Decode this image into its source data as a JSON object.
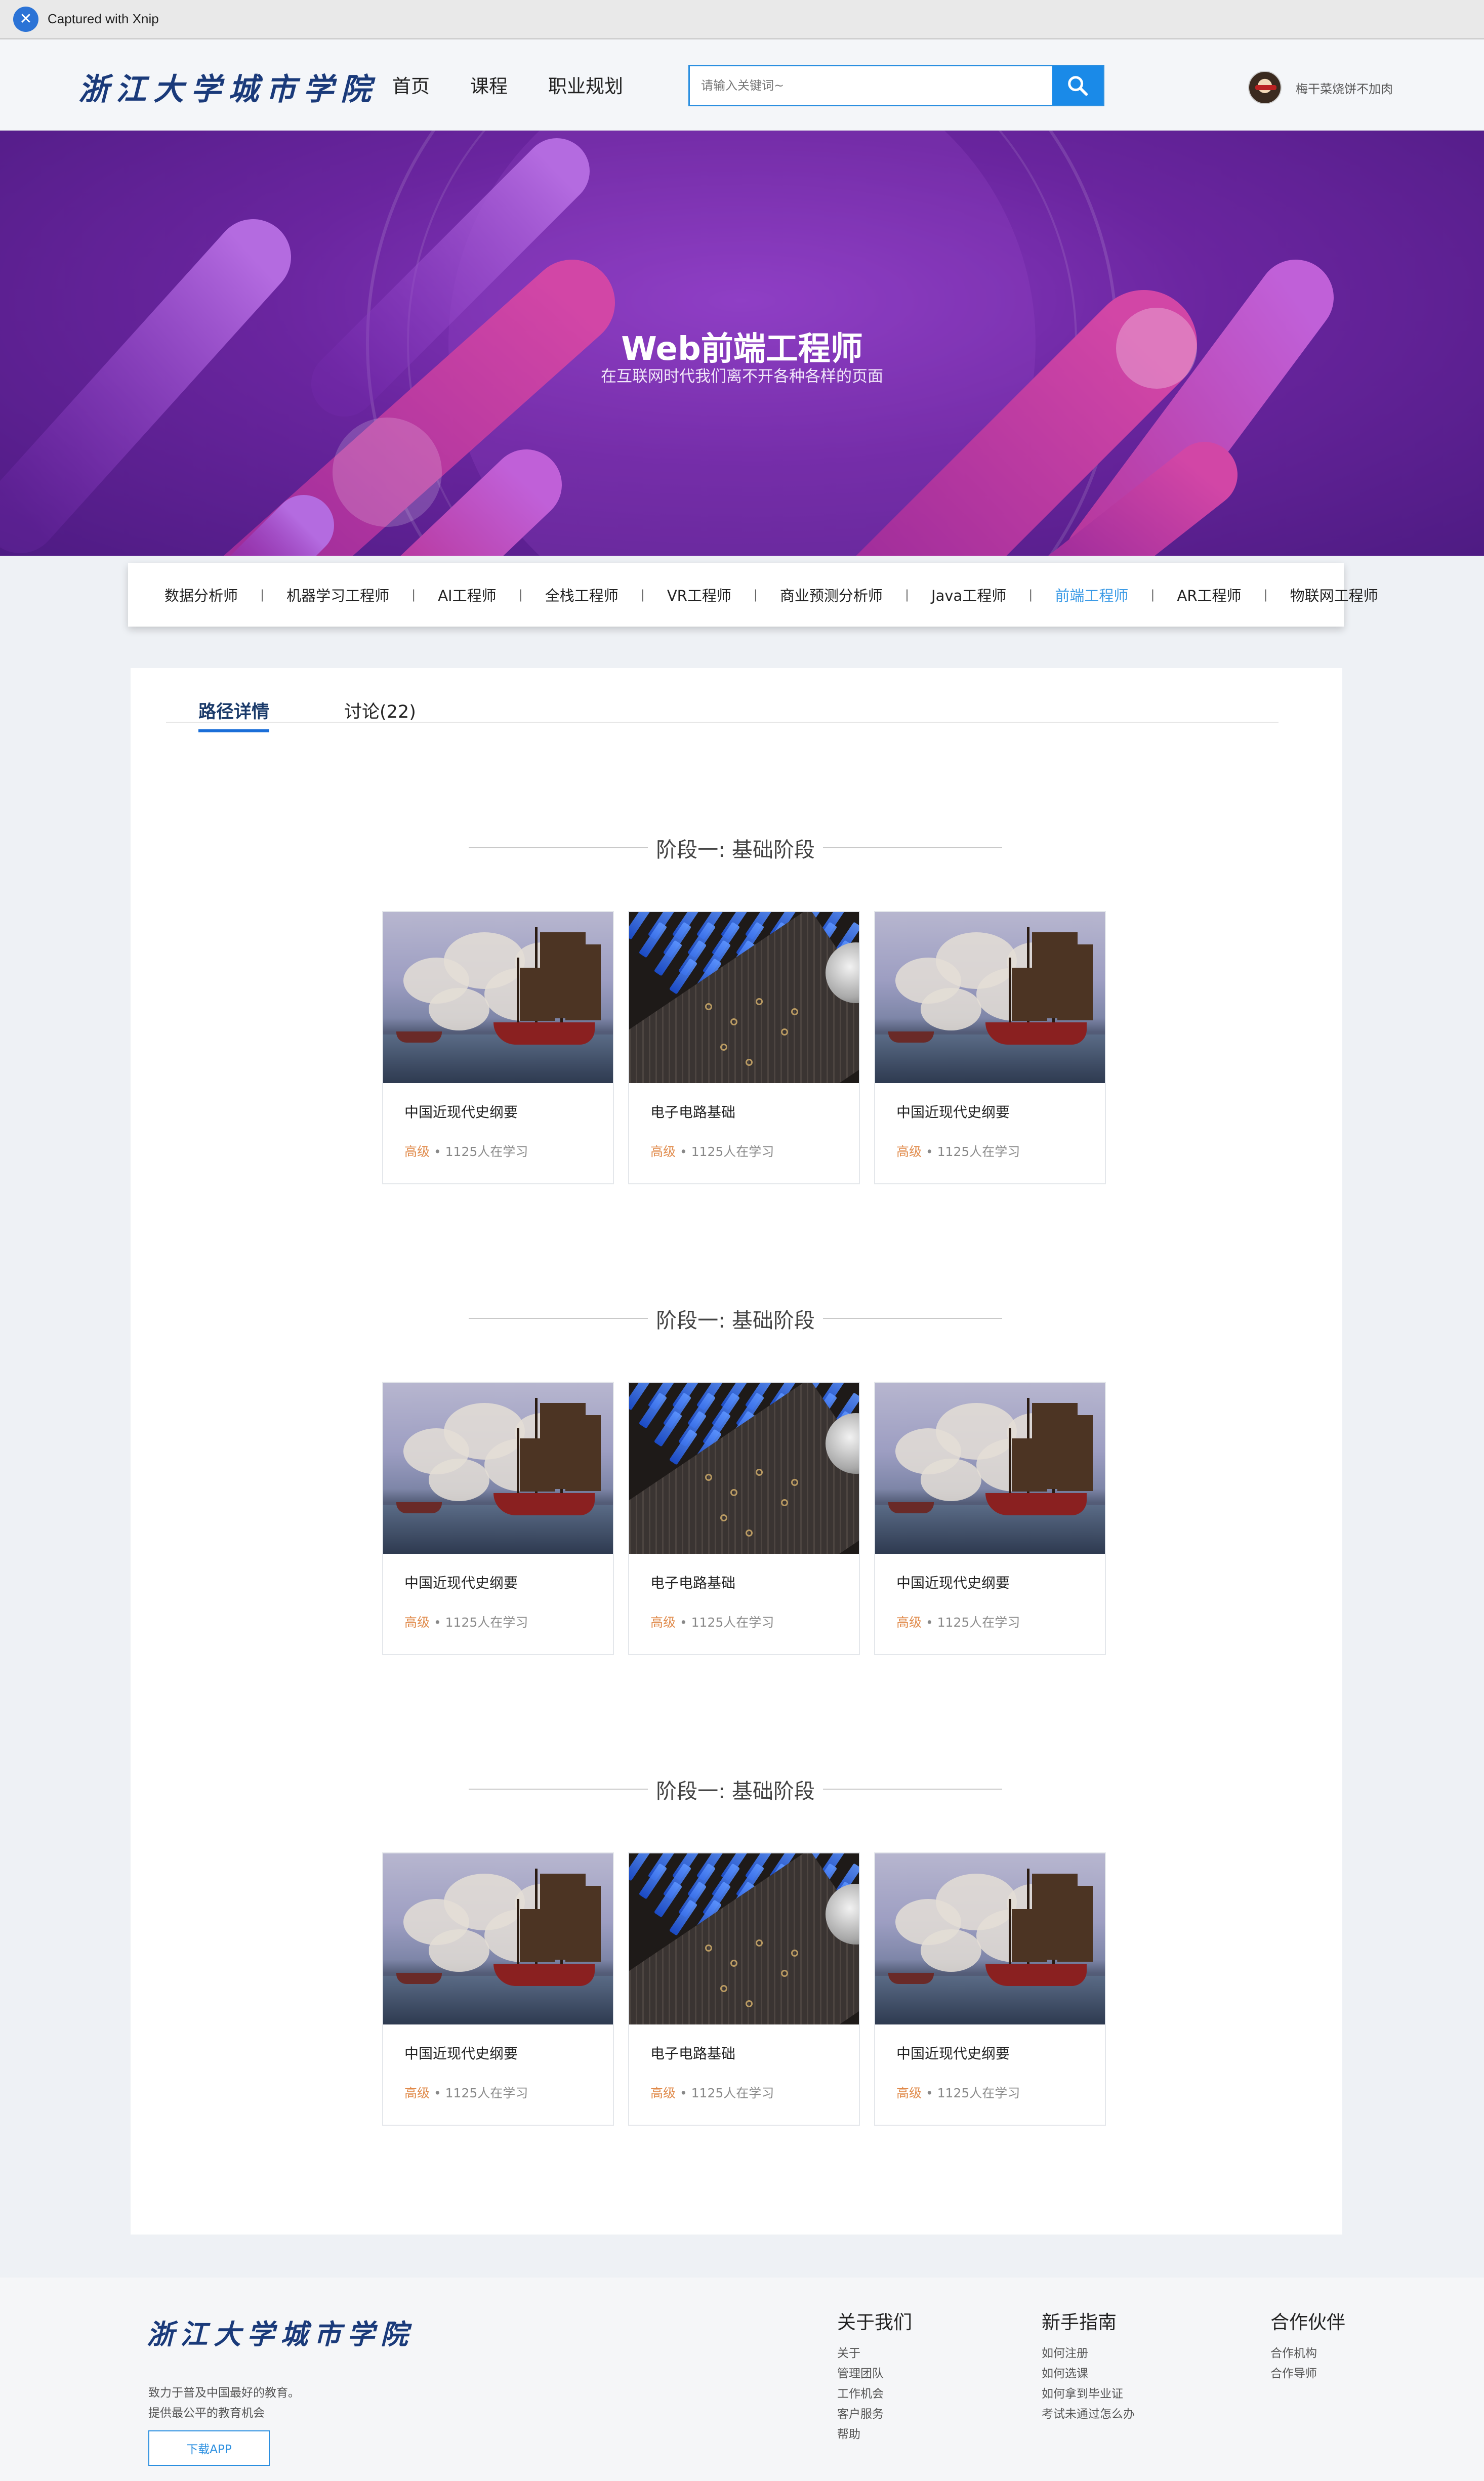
{
  "capture": {
    "label": "Captured with Xnip"
  },
  "header": {
    "logo_text": "浙江大学城市学院",
    "nav": [
      "首页",
      "课程",
      "职业规划"
    ],
    "search_placeholder": "请输入关键词~",
    "user_name": "梅干菜烧饼不加肉"
  },
  "banner": {
    "title": "Web前端工程师",
    "subtitle": "在互联网时代我们离不开各种各样的页面"
  },
  "categories": {
    "items": [
      "数据分析师",
      "机器学习工程师",
      "AI工程师",
      "全栈工程师",
      "VR工程师",
      "商业预测分析师",
      "Java工程师",
      "前端工程师",
      "AR工程师",
      "物联网工程师"
    ],
    "active": "前端工程师"
  },
  "tabs": {
    "detail": "路径详情",
    "discuss": "讨论(22)"
  },
  "stages": [
    {
      "title": "阶段一: 基础阶段",
      "courses": [
        {
          "title": "中国近现代史纲要",
          "level": "高级",
          "learners": "1125人在学习",
          "image": "ship-painting"
        },
        {
          "title": "电子电路基础",
          "level": "高级",
          "learners": "1125人在学习",
          "image": "circuit-board"
        },
        {
          "title": "中国近现代史纲要",
          "level": "高级",
          "learners": "1125人在学习",
          "image": "ship-painting"
        }
      ]
    },
    {
      "title": "阶段一: 基础阶段",
      "courses": [
        {
          "title": "中国近现代史纲要",
          "level": "高级",
          "learners": "1125人在学习",
          "image": "ship-painting"
        },
        {
          "title": "电子电路基础",
          "level": "高级",
          "learners": "1125人在学习",
          "image": "circuit-board"
        },
        {
          "title": "中国近现代史纲要",
          "level": "高级",
          "learners": "1125人在学习",
          "image": "ship-painting"
        }
      ]
    },
    {
      "title": "阶段一: 基础阶段",
      "courses": [
        {
          "title": "中国近现代史纲要",
          "level": "高级",
          "learners": "1125人在学习",
          "image": "ship-painting"
        },
        {
          "title": "电子电路基础",
          "level": "高级",
          "learners": "1125人在学习",
          "image": "circuit-board"
        },
        {
          "title": "中国近现代史纲要",
          "level": "高级",
          "learners": "1125人在学习",
          "image": "ship-painting"
        }
      ]
    }
  ],
  "footer": {
    "logo_text": "浙江大学城市学院",
    "desc_lines": [
      "致力于普及中国最好的教育。",
      "提供最公平的教育机会"
    ],
    "download_label": "下载APP",
    "columns": [
      {
        "title": "关于我们",
        "links": [
          "关于",
          "管理团队",
          "工作机会",
          "客户服务",
          "帮助"
        ]
      },
      {
        "title": "新手指南",
        "links": [
          "如何注册",
          "如何选课",
          "如何拿到毕业证",
          "考试未通过怎么办"
        ]
      },
      {
        "title": "合作伙伴",
        "links": [
          "合作机构",
          "合作导师"
        ]
      }
    ]
  },
  "colors": {
    "brand_blue": "#1a8ae8",
    "active_category": "#3c9be6",
    "level_orange": "#e08a4a",
    "banner_purple": "#6a259f"
  }
}
